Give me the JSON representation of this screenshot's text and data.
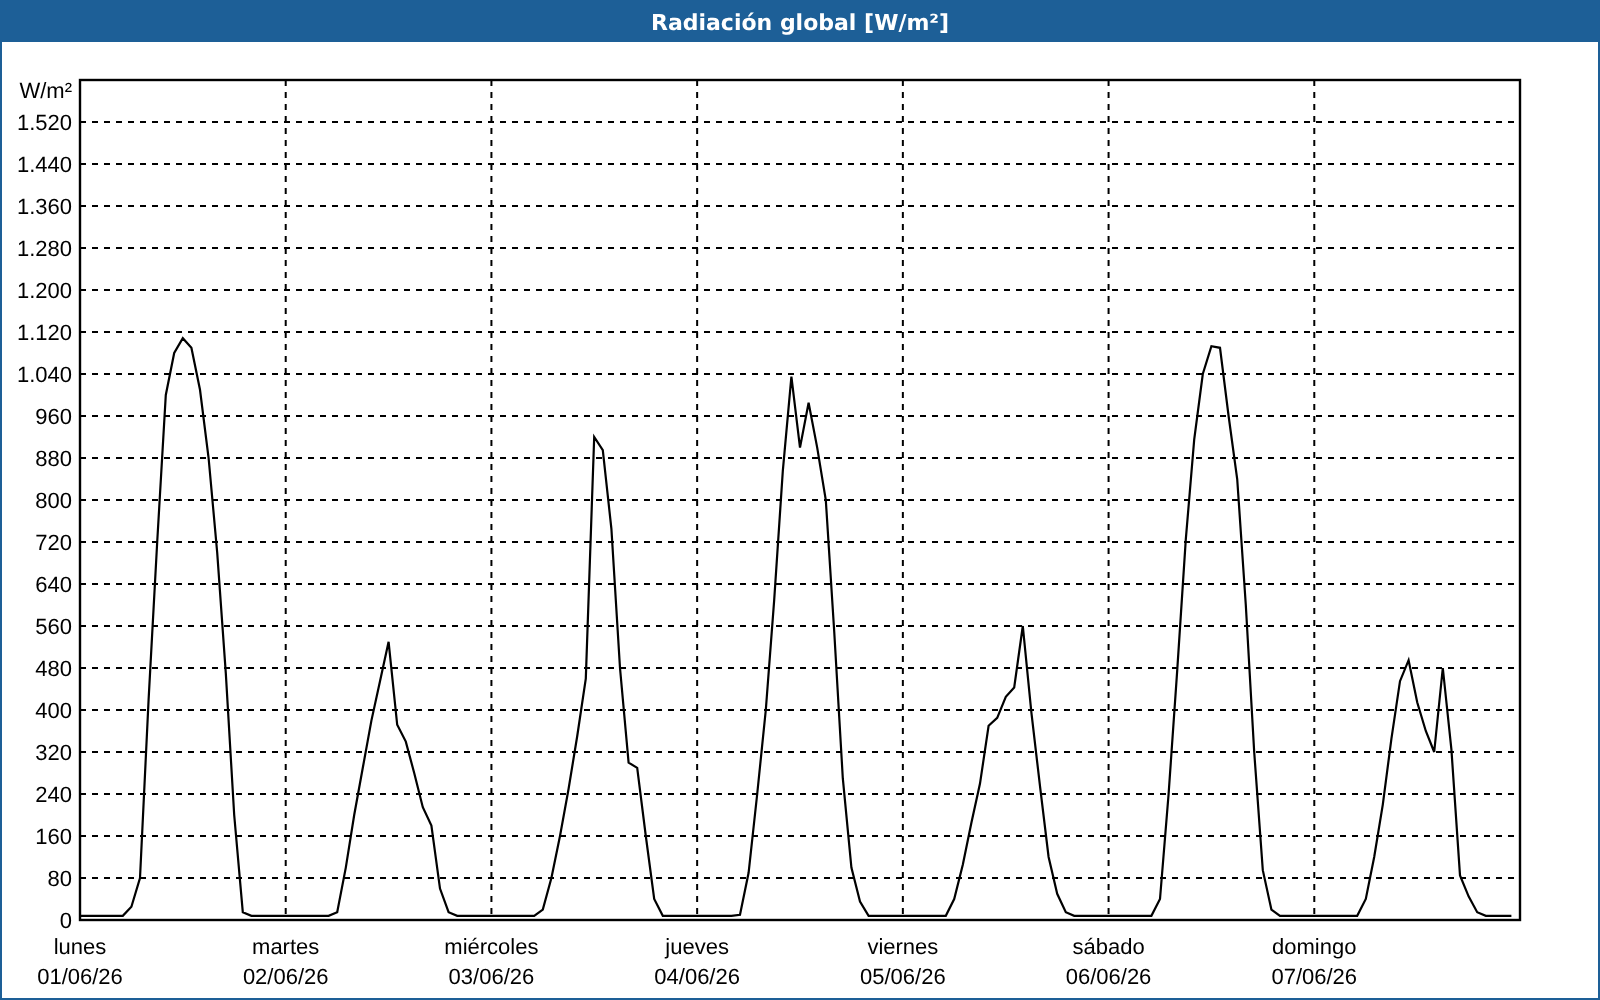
{
  "window": {
    "title": "Radiación global [W/m²]"
  },
  "chart": {
    "chart_data": {
      "type": "line",
      "grid": true,
      "ylabel": "W/m²",
      "ylim": [
        0,
        1600
      ],
      "yticks": [
        {
          "value": 0,
          "label": "0"
        },
        {
          "value": 80,
          "label": "80"
        },
        {
          "value": 160,
          "label": "160"
        },
        {
          "value": 240,
          "label": "240"
        },
        {
          "value": 320,
          "label": "320"
        },
        {
          "value": 400,
          "label": "400"
        },
        {
          "value": 480,
          "label": "480"
        },
        {
          "value": 560,
          "label": "560"
        },
        {
          "value": 640,
          "label": "640"
        },
        {
          "value": 720,
          "label": "720"
        },
        {
          "value": 800,
          "label": "800"
        },
        {
          "value": 880,
          "label": "880"
        },
        {
          "value": 960,
          "label": "960"
        },
        {
          "value": 1040,
          "label": "1.040"
        },
        {
          "value": 1120,
          "label": "1.120"
        },
        {
          "value": 1200,
          "label": "1.200"
        },
        {
          "value": 1280,
          "label": "1.280"
        },
        {
          "value": 1360,
          "label": "1.360"
        },
        {
          "value": 1440,
          "label": "1.440"
        },
        {
          "value": 1520,
          "label": "1.520"
        }
      ],
      "categories": [
        "lunes\n01/06/26",
        null,
        null,
        null,
        null,
        null,
        null,
        null,
        null,
        null,
        null,
        null,
        null,
        null,
        null,
        null,
        null,
        null,
        null,
        null,
        null,
        null,
        null,
        null,
        "martes\n02/06/26",
        null,
        null,
        null,
        null,
        null,
        null,
        null,
        null,
        null,
        null,
        null,
        null,
        null,
        null,
        null,
        null,
        null,
        null,
        null,
        null,
        null,
        null,
        null,
        "miércoles\n03/06/26",
        null,
        null,
        null,
        null,
        null,
        null,
        null,
        null,
        null,
        null,
        null,
        null,
        null,
        null,
        null,
        null,
        null,
        null,
        null,
        null,
        null,
        null,
        null,
        "jueves\n04/06/26",
        null,
        null,
        null,
        null,
        null,
        null,
        null,
        null,
        null,
        null,
        null,
        null,
        null,
        null,
        null,
        null,
        null,
        null,
        null,
        null,
        null,
        null,
        null,
        "viernes\n05/06/26",
        null,
        null,
        null,
        null,
        null,
        null,
        null,
        null,
        null,
        null,
        null,
        null,
        null,
        null,
        null,
        null,
        null,
        null,
        null,
        null,
        null,
        null,
        null,
        "sábado\n06/06/26",
        null,
        null,
        null,
        null,
        null,
        null,
        null,
        null,
        null,
        null,
        null,
        null,
        null,
        null,
        null,
        null,
        null,
        null,
        null,
        null,
        null,
        null,
        null,
        "domingo\n07/06/26",
        null,
        null,
        null,
        null,
        null,
        null,
        null,
        null,
        null,
        null,
        null,
        null,
        null,
        null,
        null,
        null,
        null,
        null,
        null,
        null,
        null,
        null,
        null
      ],
      "series": [
        {
          "color": "#000000",
          "values": [
            8,
            8,
            8,
            8,
            8,
            8,
            25,
            80,
            420,
            720,
            1000,
            1080,
            1108,
            1090,
            1010,
            880,
            700,
            470,
            200,
            15,
            8,
            8,
            8,
            8,
            8,
            8,
            8,
            8,
            8,
            8,
            15,
            100,
            200,
            290,
            380,
            455,
            530,
            372,
            340,
            280,
            215,
            180,
            60,
            15,
            8,
            8,
            8,
            8,
            8,
            8,
            8,
            8,
            8,
            8,
            20,
            80,
            160,
            250,
            350,
            460,
            920,
            895,
            745,
            480,
            300,
            290,
            160,
            40,
            8,
            8,
            8,
            8,
            8,
            8,
            8,
            8,
            8,
            10,
            90,
            240,
            400,
            610,
            855,
            1035,
            900,
            985,
            900,
            800,
            550,
            270,
            100,
            35,
            8,
            8,
            8,
            8,
            8,
            8,
            8,
            8,
            8,
            8,
            40,
            105,
            185,
            260,
            370,
            385,
            425,
            443,
            560,
            395,
            255,
            120,
            50,
            15,
            8,
            8,
            8,
            8,
            8,
            8,
            8,
            8,
            8,
            8,
            40,
            240,
            475,
            725,
            915,
            1040,
            1093,
            1090,
            960,
            840,
            600,
            320,
            95,
            20,
            8,
            8,
            8,
            8,
            8,
            8,
            8,
            8,
            8,
            8,
            40,
            120,
            220,
            345,
            455,
            495,
            415,
            360,
            320,
            480,
            325,
            85,
            45,
            15,
            8,
            8,
            8,
            8
          ]
        }
      ]
    }
  }
}
